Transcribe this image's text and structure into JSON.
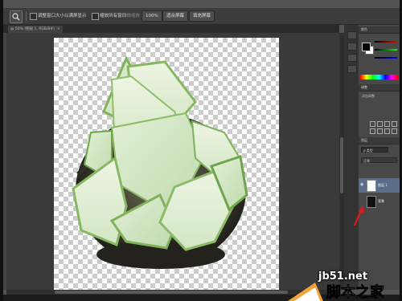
{
  "options_bar": {
    "opt1": "调整窗口大小以满屏显示",
    "opt2": "缩放所有窗口",
    "opt3": "细微缩放",
    "zoom": "100%",
    "fit_screen": "适合屏幕",
    "fill_screen": "填充屏幕"
  },
  "document_tab": {
    "title": "@ 50% (图层 1, RGB/8#)",
    "close": "×"
  },
  "panels": {
    "color_head": "颜色",
    "adjust_head": "调整",
    "add_adjust": "添加调整",
    "layers_head": "图层",
    "filter": "ρ 类型",
    "blend": "正常",
    "layers": [
      {
        "name": "图层 1",
        "selected": true,
        "eye": "◉"
      },
      {
        "name": "背景",
        "selected": false,
        "eye": ""
      }
    ]
  },
  "watermark": {
    "url": "jb51.net",
    "text": "脚本之家"
  },
  "colors": {
    "accent_selected": "#5a6e89",
    "arrow": "#e01818",
    "checker": "#cccccc"
  }
}
